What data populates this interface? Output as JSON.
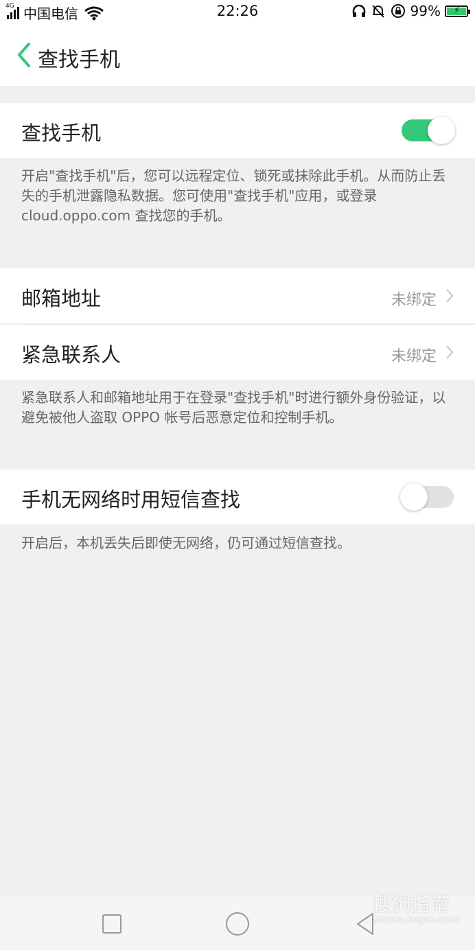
{
  "status": {
    "network_type": "4G",
    "carrier": "中国电信",
    "time": "22:26",
    "battery": "99%"
  },
  "header": {
    "title": "查找手机"
  },
  "find_phone": {
    "label": "查找手机",
    "enabled": true,
    "note": "开启\"查找手机\"后，您可以远程定位、锁死或抹除此手机。从而防止丢失的手机泄露隐私数据。您可使用\"查找手机\"应用，或登录 cloud.oppo.com 查找您的手机。"
  },
  "bindings": {
    "email": {
      "label": "邮箱地址",
      "value": "未绑定"
    },
    "emergency": {
      "label": "紧急联系人",
      "value": "未绑定"
    },
    "note": "紧急联系人和邮箱地址用于在登录\"查找手机\"时进行额外身份验证，以避免被他人盗取 OPPO 帐号后恶意定位和控制手机。"
  },
  "sms_find": {
    "label": "手机无网络时用短信查找",
    "enabled": false,
    "note": "开启后，本机丢失后即使无网络，仍可通过短信查找。"
  },
  "watermark": {
    "brand": "搜狗指南",
    "domain": "zhinan.sogou.com"
  },
  "colors": {
    "accent": "#34c978",
    "background": "#f0f0f0"
  }
}
